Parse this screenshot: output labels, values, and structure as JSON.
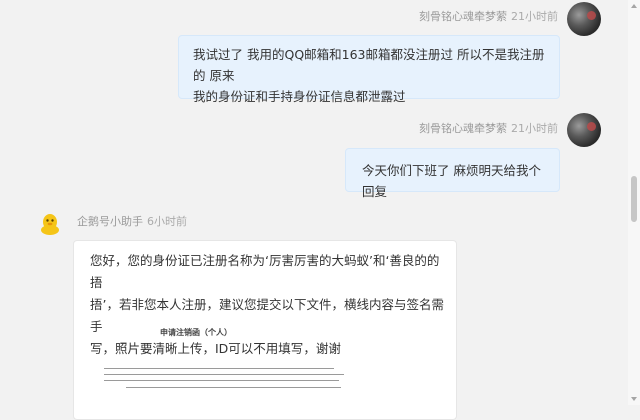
{
  "messages": [
    {
      "sender": "刻骨铭心魂牵梦萦",
      "time": "21小时前",
      "lines": [
        "我试过了 我用的QQ邮箱和163邮箱都没注册过 所以不是我注册的 原来",
        "我的身份证和手持身份证信息都泄露过"
      ]
    },
    {
      "sender": "刻骨铭心魂牵梦萦",
      "time": "21小时前",
      "lines": [
        "今天你们下班了 麻烦明天给我个回复"
      ]
    },
    {
      "sender": "企鹅号小助手",
      "time": "6小时前",
      "lines": [
        "您好，您的身份证已注册名称为‘厉害厉害的大蚂蚁’和‘善良的的捂",
        "捂’，若非您本人注册，建议您提交以下文件，横线内容与签名需手",
        "写，照片要清晰上传，ID可以不用填写，谢谢"
      ],
      "document": {
        "title": "申请注销函（个人）"
      }
    }
  ],
  "colors": {
    "my_bubble": "#e7f2fd",
    "bot_bubble": "#ffffff",
    "background": "#f2f2f2",
    "bot_avatar": "#f5c518"
  },
  "icons": {
    "bot_avatar": "penguin-icon",
    "user_avatar": "user-avatar"
  }
}
